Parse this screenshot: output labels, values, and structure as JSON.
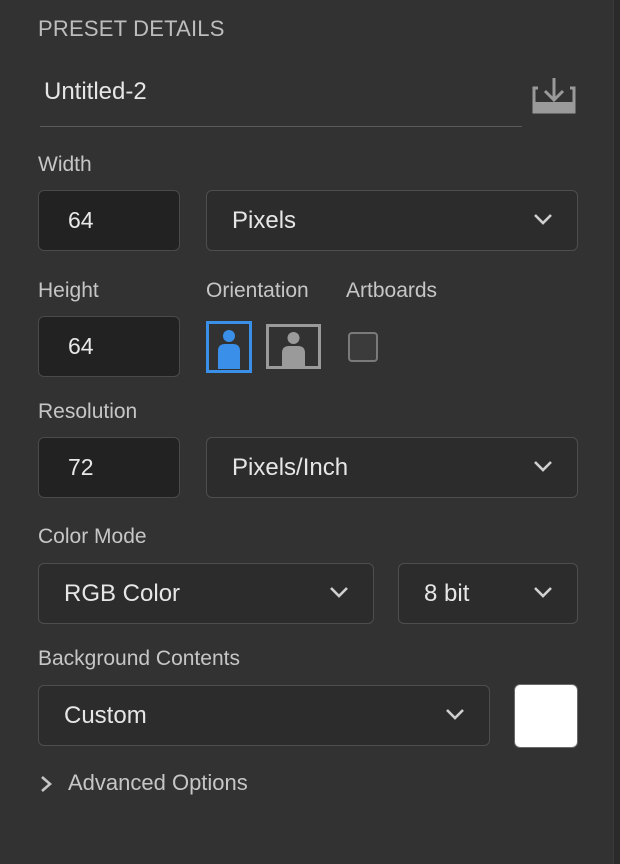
{
  "panel": {
    "section_title": "PRESET DETAILS",
    "preset_name": "Untitled-2",
    "save_preset_icon": "save-preset-icon"
  },
  "width": {
    "label": "Width",
    "value": "64",
    "unit": "Pixels"
  },
  "height": {
    "label": "Height",
    "value": "64"
  },
  "orientation": {
    "label": "Orientation",
    "selected": "portrait",
    "options": [
      "portrait",
      "landscape"
    ]
  },
  "artboards": {
    "label": "Artboards",
    "checked": false
  },
  "resolution": {
    "label": "Resolution",
    "value": "72",
    "unit": "Pixels/Inch"
  },
  "color_mode": {
    "label": "Color Mode",
    "mode": "RGB Color",
    "depth": "8 bit"
  },
  "background": {
    "label": "Background Contents",
    "value": "Custom",
    "swatch_color": "#ffffff"
  },
  "advanced": {
    "label": "Advanced Options"
  },
  "colors": {
    "panel_bg": "#323232",
    "accent": "#3a8fe8"
  }
}
